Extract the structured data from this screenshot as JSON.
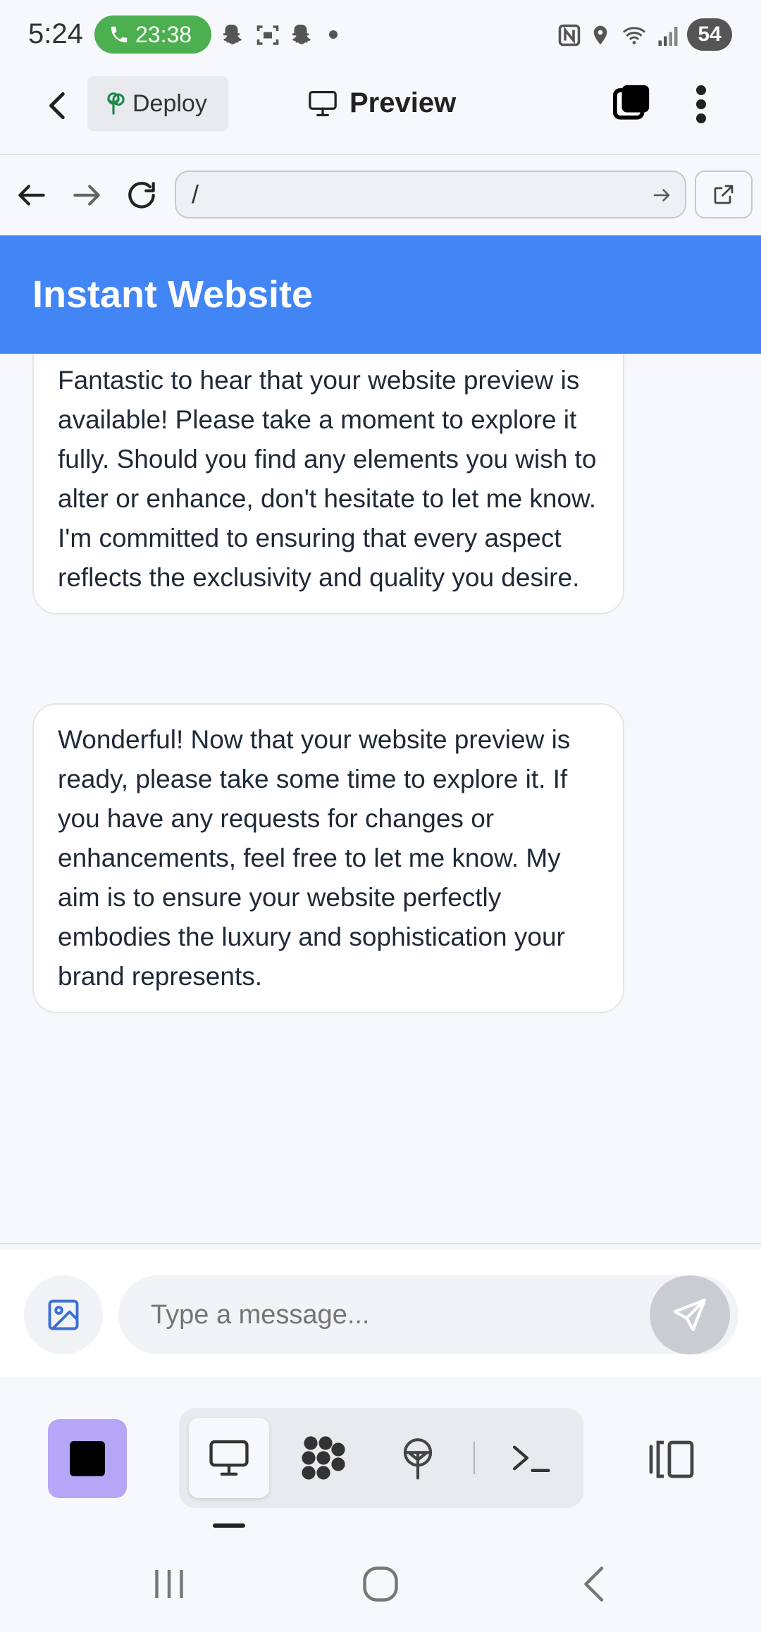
{
  "status_bar": {
    "time": "5:24",
    "call_timer": "23:38",
    "battery": "54"
  },
  "header": {
    "deploy_label": "Deploy",
    "preview_label": "Preview"
  },
  "browser": {
    "url": "/"
  },
  "site": {
    "title": "Instant Website"
  },
  "messages": [
    {
      "text": "Fantastic to hear that your website preview is available! Please take a moment to explore it fully. Should you find any elements you wish to alter or enhance, don't hesitate to let me know. I'm committed to ensuring that every aspect reflects the exclusivity and quality you desire."
    },
    {
      "text": "Wonderful! Now that your website preview is ready, please take some time to explore it. If you have any requests for changes or enhancements, feel free to let me know. My aim is to ensure your website perfectly embodies the luxury and sophistication your brand represents."
    }
  ],
  "composer": {
    "placeholder": "Type a message..."
  },
  "colors": {
    "accent_blue": "#4285f4",
    "call_green": "#4caf50",
    "stop_purple": "#b5a6f7"
  }
}
